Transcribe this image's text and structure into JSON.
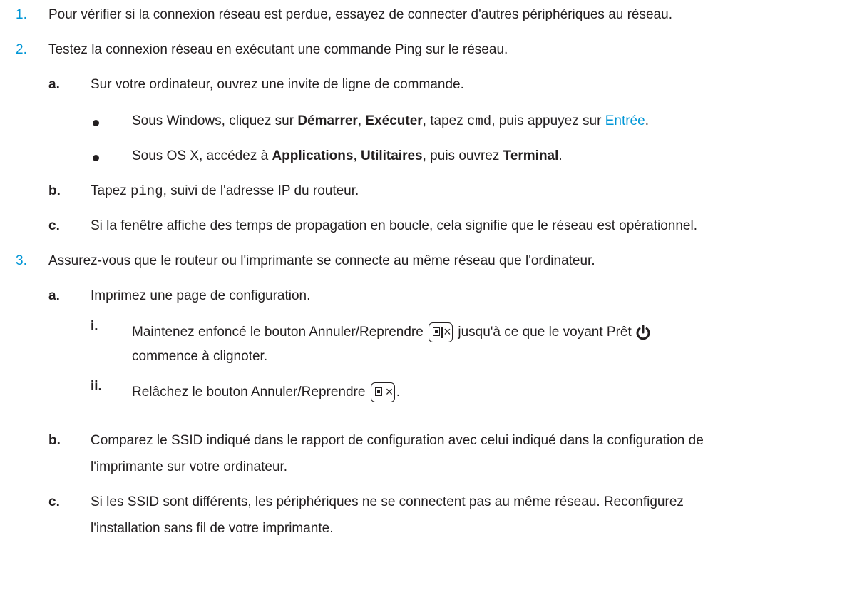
{
  "steps": {
    "s1": {
      "num": "1.",
      "text": "Pour vérifier si la connexion réseau est perdue, essayez de connecter d'autres périphériques au réseau."
    },
    "s2": {
      "num": "2.",
      "text": "Testez la connexion réseau en exécutant une commande Ping sur le réseau.",
      "a": {
        "num": "a.",
        "text": "Sur votre ordinateur, ouvrez une invite de ligne de commande."
      },
      "bullet1": {
        "t1": "Sous Windows, cliquez sur ",
        "b1": "Démarrer",
        "t2": ", ",
        "b2": "Exécuter",
        "t3": ", tapez ",
        "code": "cmd",
        "t4": ", puis appuyez sur ",
        "link": "Entrée",
        "t5": "."
      },
      "bullet2": {
        "t1": "Sous OS X, accédez à ",
        "b1": "Applications",
        "t2": ", ",
        "b2": "Utilitaires",
        "t3": ", puis ouvrez ",
        "b3": "Terminal",
        "t4": "."
      },
      "b": {
        "num": "b.",
        "t1": "Tapez ",
        "code": "ping",
        "t2": ", suivi de l'adresse IP du routeur."
      },
      "c": {
        "num": "c.",
        "text": "Si la fenêtre affiche des temps de propagation en boucle, cela signifie que le réseau est opérationnel."
      }
    },
    "s3": {
      "num": "3.",
      "text": "Assurez-vous que le routeur ou l'imprimante se connecte au même réseau que l'ordinateur.",
      "a": {
        "num": "a.",
        "text": "Imprimez une page de configuration."
      },
      "i": {
        "num": "i.",
        "t1": "Maintenez enfoncé le bouton Annuler/Reprendre",
        "t2": "jusqu'à ce que le voyant Prêt",
        "t3": "commence à clignoter."
      },
      "ii": {
        "num": "ii.",
        "t1": "Relâchez le bouton Annuler/Reprendre",
        "t2": "."
      },
      "b": {
        "num": "b.",
        "l1": "Comparez le SSID indiqué dans le rapport de configuration avec celui indiqué dans la configuration de",
        "l2": "l'imprimante sur votre ordinateur."
      },
      "c": {
        "num": "c.",
        "l1": "Si les SSID sont différents, les périphériques ne se connectent pas au même réseau. Reconfigurez",
        "l2": "l'installation sans fil de votre imprimante."
      }
    }
  },
  "icons": {
    "cancel_resume": "cancel-resume-button-icon",
    "power": "power-icon"
  },
  "colors": {
    "number": "#0096d6",
    "link": "#0096d6",
    "text": "#231f20"
  }
}
